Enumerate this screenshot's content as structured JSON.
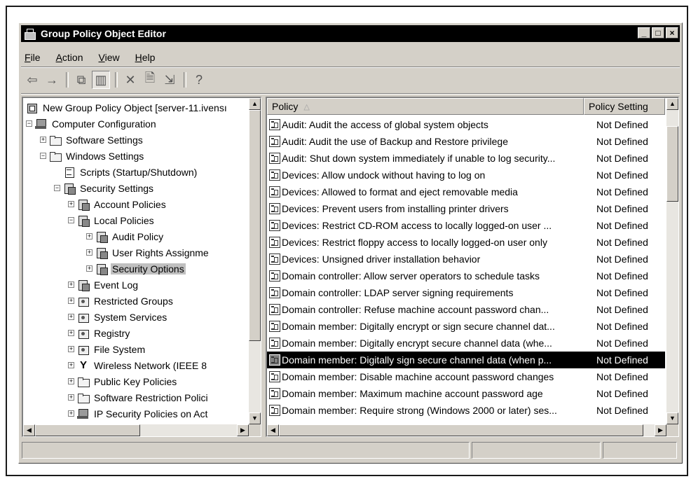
{
  "window": {
    "title": "Group Policy Object Editor"
  },
  "menubar": {
    "items": [
      {
        "label": "File"
      },
      {
        "label": "Action"
      },
      {
        "label": "View"
      },
      {
        "label": "Help"
      }
    ]
  },
  "toolbar": {
    "buttons": [
      {
        "icon": "back-arrow-icon",
        "glyph": "⇦"
      },
      {
        "icon": "forward-arrow-icon",
        "glyph": "→"
      },
      {
        "icon": "up-folder-icon",
        "glyph": "⧉"
      },
      {
        "icon": "show-hide-tree-icon",
        "glyph": "▥"
      },
      {
        "icon": "delete-icon",
        "glyph": "✕"
      },
      {
        "icon": "properties-icon",
        "glyph": "🗎"
      },
      {
        "icon": "export-list-icon",
        "glyph": "⇲"
      },
      {
        "icon": "help-icon",
        "glyph": "?"
      }
    ]
  },
  "tree": {
    "items": [
      {
        "label": "New Group Policy Object [server-11.ivensı",
        "icon": "gpo-icon"
      },
      {
        "label": "Computer Configuration",
        "icon": "computer-icon",
        "expander": "−"
      },
      {
        "label": "Software Settings",
        "icon": "folder-icon",
        "expander": "+"
      },
      {
        "label": "Windows Settings",
        "icon": "folder-icon",
        "expander": "−"
      },
      {
        "label": "Scripts (Startup/Shutdown)",
        "icon": "script-icon"
      },
      {
        "label": "Security Settings",
        "icon": "security-settings-icon",
        "expander": "−"
      },
      {
        "label": "Account Policies",
        "icon": "policy-icon",
        "expander": "+"
      },
      {
        "label": "Local Policies",
        "icon": "policy-icon",
        "expander": "−"
      },
      {
        "label": "Audit Policy",
        "icon": "policy-icon",
        "expander": "+"
      },
      {
        "label": "User Rights Assignme",
        "icon": "policy-icon",
        "expander": "+"
      },
      {
        "label": "Security Options",
        "icon": "policy-icon",
        "expander": "+",
        "selected": true
      },
      {
        "label": "Event Log",
        "icon": "policy-icon",
        "expander": "+"
      },
      {
        "label": "Restricted Groups",
        "icon": "lock-icon",
        "expander": "+"
      },
      {
        "label": "System Services",
        "icon": "lock-icon",
        "expander": "+"
      },
      {
        "label": "Registry",
        "icon": "lock-icon",
        "expander": "+"
      },
      {
        "label": "File System",
        "icon": "lock-icon",
        "expander": "+"
      },
      {
        "label": "Wireless Network (IEEE 8",
        "icon": "antenna-icon",
        "expander": "+"
      },
      {
        "label": "Public Key Policies",
        "icon": "folder-icon",
        "expander": "+"
      },
      {
        "label": "Software Restriction Polici",
        "icon": "folder-icon",
        "expander": "+"
      },
      {
        "label": "IP Security Policies on Act",
        "icon": "computer-icon",
        "expander": "+"
      }
    ]
  },
  "list": {
    "columns": [
      {
        "label": "Policy"
      },
      {
        "label": "Policy Setting"
      }
    ],
    "rows": [
      {
        "policy": "Audit: Audit the access of global system objects",
        "setting": "Not Defined"
      },
      {
        "policy": "Audit: Audit the use of Backup and Restore privilege",
        "setting": "Not Defined"
      },
      {
        "policy": "Audit: Shut down system immediately if unable to log security...",
        "setting": "Not Defined"
      },
      {
        "policy": "Devices: Allow undock without having to log on",
        "setting": "Not Defined"
      },
      {
        "policy": "Devices: Allowed to format and eject removable media",
        "setting": "Not Defined"
      },
      {
        "policy": "Devices: Prevent users from installing printer drivers",
        "setting": "Not Defined"
      },
      {
        "policy": "Devices: Restrict CD-ROM access to locally logged-on user ...",
        "setting": "Not Defined"
      },
      {
        "policy": "Devices: Restrict floppy access to locally logged-on user only",
        "setting": "Not Defined"
      },
      {
        "policy": "Devices: Unsigned driver installation behavior",
        "setting": "Not Defined"
      },
      {
        "policy": "Domain controller: Allow server operators to schedule tasks",
        "setting": "Not Defined"
      },
      {
        "policy": "Domain controller: LDAP server signing requirements",
        "setting": "Not Defined"
      },
      {
        "policy": "Domain controller: Refuse machine account password chan...",
        "setting": "Not Defined"
      },
      {
        "policy": "Domain member: Digitally encrypt or sign secure channel dat...",
        "setting": "Not Defined"
      },
      {
        "policy": "Domain member: Digitally encrypt secure channel data (whe...",
        "setting": "Not Defined"
      },
      {
        "policy": "Domain member: Digitally sign secure channel data (when p...",
        "setting": "Not Defined",
        "selected": true
      },
      {
        "policy": "Domain member: Disable machine account password changes",
        "setting": "Not Defined"
      },
      {
        "policy": "Domain member: Maximum machine account password age",
        "setting": "Not Defined"
      },
      {
        "policy": "Domain member: Require strong (Windows 2000 or later) ses...",
        "setting": "Not Defined"
      }
    ]
  },
  "scroll": {
    "up": "▲",
    "down": "▼",
    "left": "◀",
    "right": "▶"
  },
  "window_buttons": {
    "minimize": "_",
    "maximize": "□",
    "close": "×"
  }
}
